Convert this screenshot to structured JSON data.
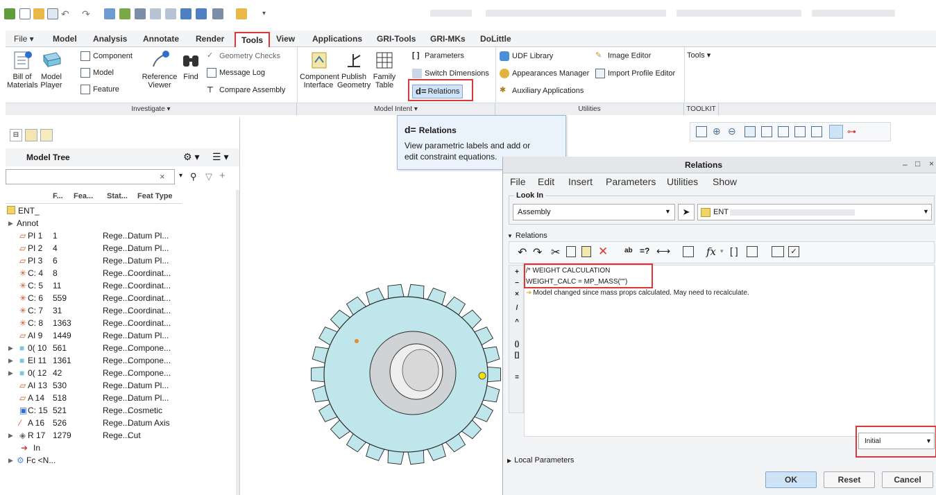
{
  "tabs": [
    "File ▾",
    "Model",
    "Analysis",
    "Annotate",
    "Render",
    "Tools",
    "View",
    "Applications",
    "GRI-Tools",
    "GRI-MKs",
    "DoLittle"
  ],
  "ribbon": {
    "investigate": {
      "bom_line1": "Bill of",
      "bom_line2": "Materials",
      "player_line1": "Model",
      "player_line2": "Player",
      "component": "Component",
      "model": "Model",
      "feature": "Feature",
      "ref_line1": "Reference",
      "ref_line2": "Viewer",
      "find": "Find",
      "geometry_checks": "Geometry Checks",
      "message_log": "Message Log",
      "compare_assembly": "Compare Assembly",
      "label": "Investigate ▾"
    },
    "model_intent": {
      "ci_line1": "Component",
      "ci_line2": "Interface",
      "pg_line1": "Publish",
      "pg_line2": "Geometry",
      "ft_line1": "Family",
      "ft_line2": "Table",
      "parameters": "Parameters",
      "switch_dimensions": "Switch Dimensions",
      "relations": "Relations",
      "label": "Model Intent ▾"
    },
    "utilities": {
      "udf_library": "UDF Library",
      "image_editor": "Image Editor",
      "appearances_manager": "Appearances Manager",
      "import_profile_editor": "Import Profile Editor",
      "auxiliary_applications": "Auxiliary Applications",
      "label": "Utilities"
    },
    "toolkit": {
      "tools": "Tools ▾",
      "label": "TOOLKIT"
    }
  },
  "tooltip": {
    "title": "Relations",
    "line1": "View parametric labels and add or",
    "line2": "edit constraint equations."
  },
  "model_tree": {
    "title": "Model Tree",
    "headers": [
      "F...",
      "Fea...",
      "Stat...",
      "Feat Type"
    ],
    "root": "ENT_",
    "annot": "Annot",
    "rows": [
      {
        "name": "PI 1",
        "num": "1",
        "status": "Rege...",
        "type": "Datum Pl...",
        "icon": "datum-plane"
      },
      {
        "name": "PI 2",
        "num": "4",
        "status": "Rege...",
        "type": "Datum Pl...",
        "icon": "datum-plane"
      },
      {
        "name": "PI 3",
        "num": "6",
        "status": "Rege...",
        "type": "Datum Pl...",
        "icon": "datum-plane"
      },
      {
        "name": "C: 4",
        "num": "8",
        "status": "Rege...",
        "type": "Coordinat...",
        "icon": "csys"
      },
      {
        "name": "C: 5",
        "num": "11",
        "status": "Rege...",
        "type": "Coordinat...",
        "icon": "csys"
      },
      {
        "name": "C: 6",
        "num": "559",
        "status": "Rege...",
        "type": "Coordinat...",
        "icon": "csys"
      },
      {
        "name": "C: 7",
        "num": "31",
        "status": "Rege...",
        "type": "Coordinat...",
        "icon": "csys"
      },
      {
        "name": "C: 8",
        "num": "1363",
        "status": "Rege...",
        "type": "Coordinat...",
        "icon": "csys"
      },
      {
        "name": "AI 9",
        "num": "1449",
        "status": "Rege...",
        "type": "Datum Pl...",
        "icon": "datum-plane"
      },
      {
        "name": "0( 10",
        "num": "561",
        "status": "Rege...",
        "type": "Compone...",
        "icon": "component"
      },
      {
        "name": "EI 11",
        "num": "1361",
        "status": "Rege...",
        "type": "Compone...",
        "icon": "component"
      },
      {
        "name": "0( 12",
        "num": "42",
        "status": "Rege...",
        "type": "Compone...",
        "icon": "component"
      },
      {
        "name": "AI 13",
        "num": "530",
        "status": "Rege...",
        "type": "Datum Pl...",
        "icon": "datum-plane"
      },
      {
        "name": "A 14",
        "num": "518",
        "status": "Rege...",
        "type": "Datum Pl...",
        "icon": "datum-plane"
      },
      {
        "name": "C: 15",
        "num": "521",
        "status": "Rege...",
        "type": "Cosmetic",
        "icon": "cosmetic"
      },
      {
        "name": "A 16",
        "num": "526",
        "status": "Rege...",
        "type": "Datum Axis",
        "icon": "axis"
      },
      {
        "name": "R 17",
        "num": "1279",
        "status": "Rege...",
        "type": "Cut",
        "icon": "cut"
      }
    ],
    "insert_here": "In",
    "footer": "Fc <N..."
  },
  "relations_dialog": {
    "title": "Relations",
    "menu": [
      "File",
      "Edit",
      "Insert",
      "Parameters",
      "Utilities",
      "Show"
    ],
    "look_in_label": "Look In",
    "look_in_value": "Assembly",
    "target_value": "ENT",
    "relations_section": "Relations",
    "editor_lines": [
      "/* WEIGHT CALCULATION",
      "WEIGHT_CALC = MP_MASS(\"\")",
      "Model changed since mass props calculated. May need to recalculate."
    ],
    "side_ops": [
      "+",
      "−",
      "×",
      "/",
      "^",
      "()",
      "[]",
      "="
    ],
    "initial_value": "Initial",
    "local_parameters": "Local Parameters",
    "ok": "OK",
    "reset": "Reset",
    "cancel": "Cancel"
  },
  "colors": {
    "highlight_red": "#d9383a",
    "gear": "#bfe6ea",
    "tooltip_bg": "#eaf3fb"
  }
}
